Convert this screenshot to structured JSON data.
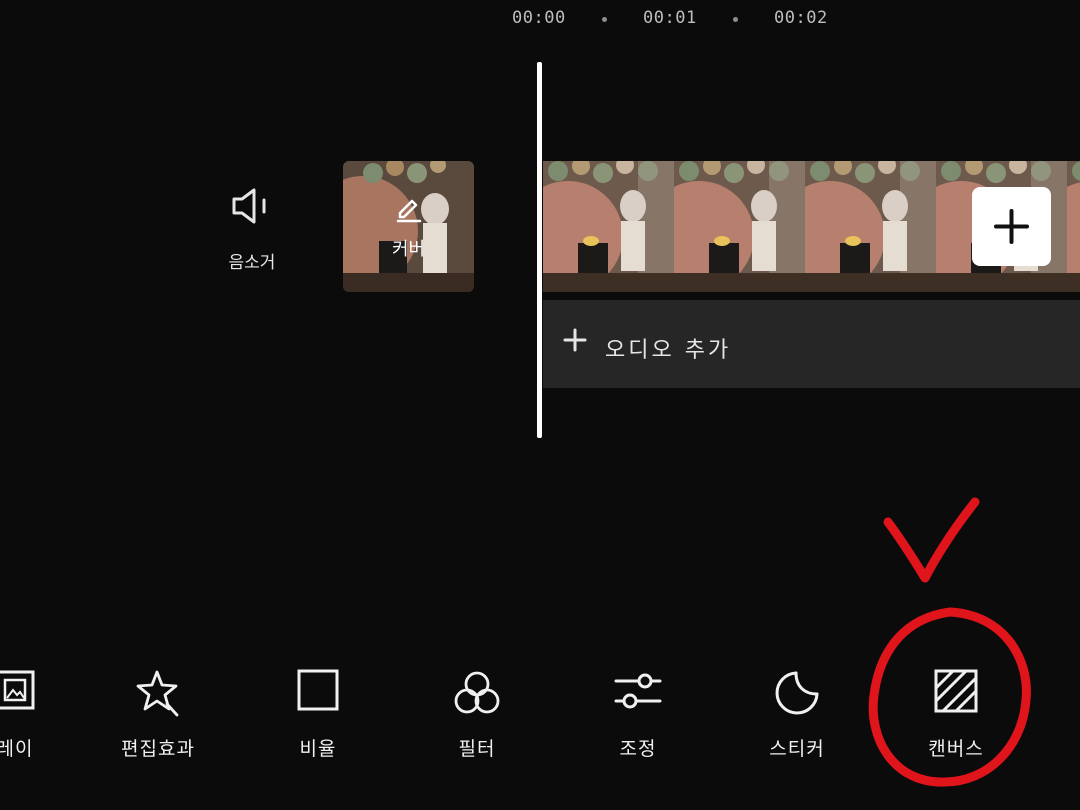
{
  "timeline": {
    "timecodes": [
      "00:00",
      "00:01",
      "00:02"
    ]
  },
  "mute": {
    "label": "음소거",
    "icon": "speaker-icon"
  },
  "cover": {
    "label": "커버",
    "icon": "pencil-icon"
  },
  "audio": {
    "label": "오디오 추가",
    "icon": "plus-icon"
  },
  "add_clip": {
    "icon": "plus-icon"
  },
  "toolbar": {
    "items": [
      {
        "label": "레이",
        "icon": "overlay-icon"
      },
      {
        "label": "편집효과",
        "icon": "magic-star-icon"
      },
      {
        "label": "비율",
        "icon": "square-icon"
      },
      {
        "label": "필터",
        "icon": "filter-circles-icon"
      },
      {
        "label": "조정",
        "icon": "sliders-icon"
      },
      {
        "label": "스티커",
        "icon": "sticker-icon"
      },
      {
        "label": "캔버스",
        "icon": "canvas-hatch-icon"
      }
    ]
  },
  "colors": {
    "background": "#0b0b0b",
    "track": "#262626",
    "annotation": "#e0141b"
  }
}
